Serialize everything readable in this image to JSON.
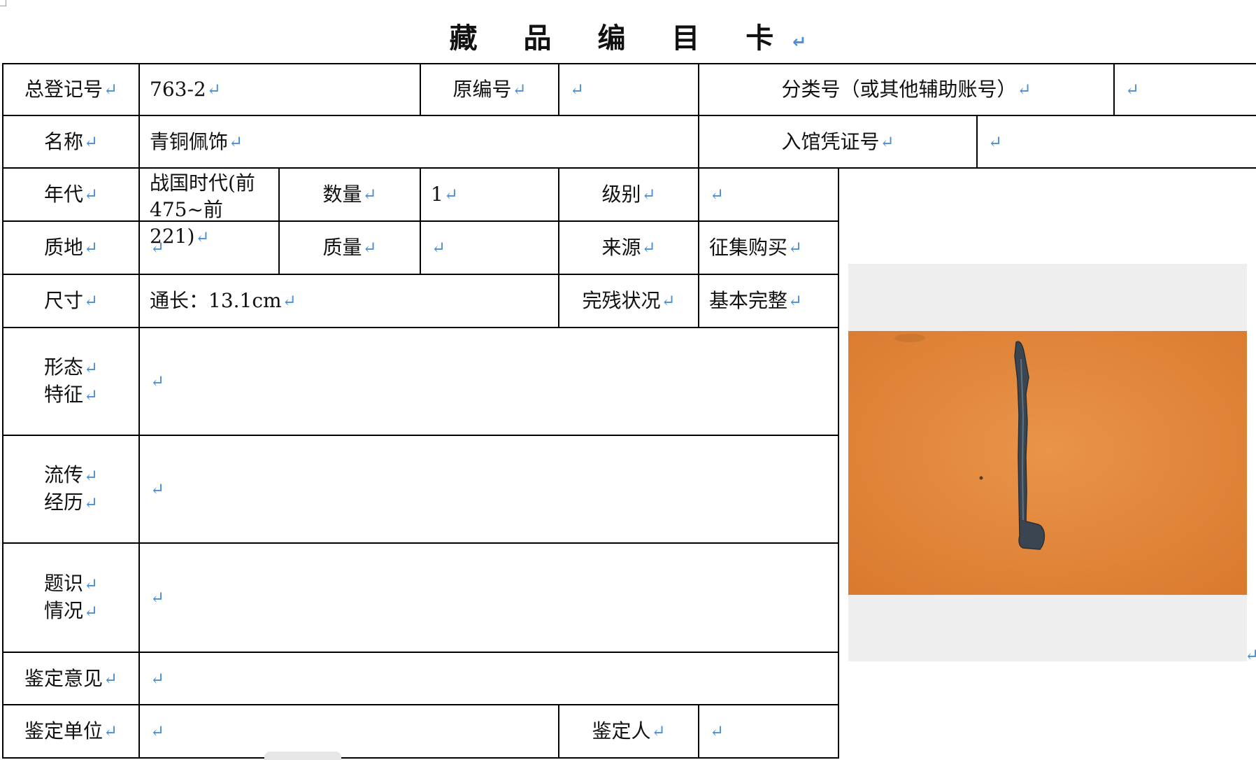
{
  "title": "藏 品 编 目 卡",
  "return_mark": "↵",
  "fields": {
    "registration_no": {
      "label": "总登记号",
      "value": "763-2"
    },
    "original_no": {
      "label": "原编号",
      "value": ""
    },
    "classification_no": {
      "label": "分类号（或其他辅助账号）",
      "value": ""
    },
    "name": {
      "label": "名称",
      "value": "青铜佩饰"
    },
    "entry_voucher_no": {
      "label": "入馆凭证号",
      "value": ""
    },
    "era": {
      "label": "年代",
      "value_line1": "战国时代(前",
      "value_line2": "475~前 221)"
    },
    "quantity": {
      "label": "数量",
      "value": "1"
    },
    "grade": {
      "label": "级别",
      "value": ""
    },
    "material": {
      "label": "质地",
      "value": ""
    },
    "mass": {
      "label": "质量",
      "value": ""
    },
    "source": {
      "label": "来源",
      "value": "征集购买"
    },
    "dimensions": {
      "label": "尺寸",
      "value": "通长：13.1cm"
    },
    "condition": {
      "label": "完残状况",
      "value": "基本完整"
    },
    "form_features": {
      "label_line1": "形态",
      "label_line2": "特征",
      "value": ""
    },
    "provenance": {
      "label_line1": "流传",
      "label_line2": "经历",
      "value": ""
    },
    "inscription": {
      "label_line1": "题识",
      "label_line2": "情况",
      "value": ""
    },
    "appraisal_opinion": {
      "label": "鉴定意见",
      "value": ""
    },
    "appraisal_unit": {
      "label": "鉴定单位",
      "value": ""
    },
    "appraiser": {
      "label": "鉴定人",
      "value": ""
    }
  },
  "colors": {
    "photo_background": "#e58a3c",
    "artifact": "#3b4550",
    "mark": "#4a8fd8"
  }
}
